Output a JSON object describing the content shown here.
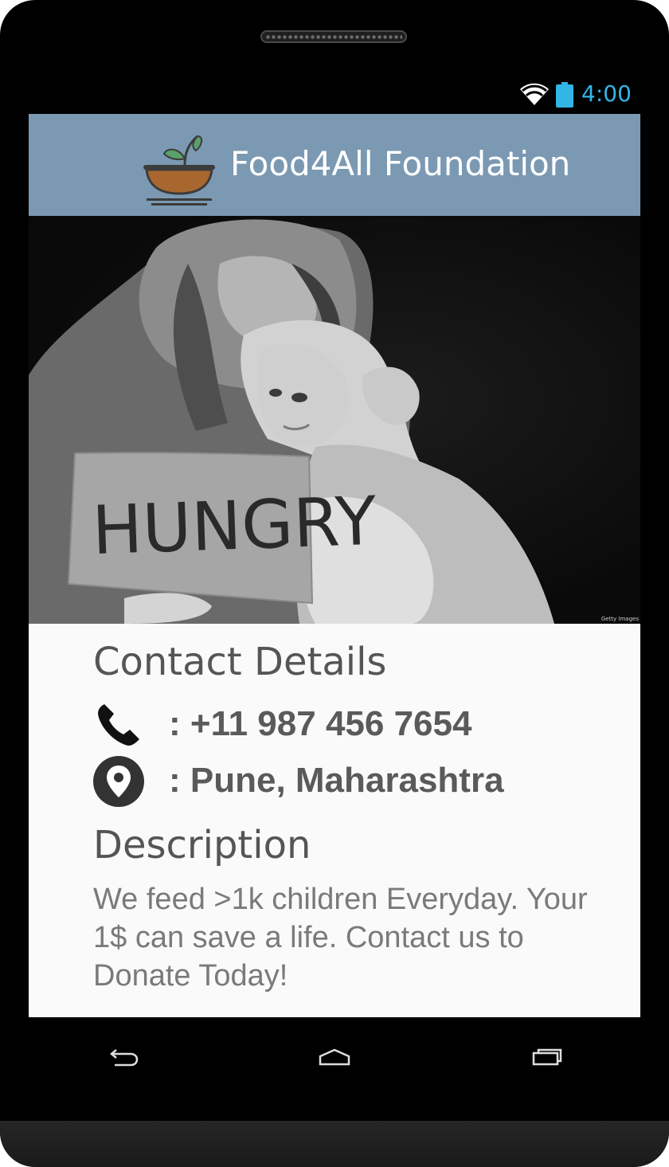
{
  "status_bar": {
    "time": "4:00",
    "wifi_icon": "wifi-icon",
    "battery_icon": "battery-icon",
    "accent_color": "#33b5e5"
  },
  "app_bar": {
    "title": "Food4All Foundation",
    "logo_icon": "plant-bowl-logo",
    "background_color": "#7b99b2"
  },
  "hero_image": {
    "sign_text": "HUNGRY",
    "watermark": "Getty Images"
  },
  "contact": {
    "heading": "Contact Details",
    "phone_icon": "phone-icon",
    "phone": ": +11 987 456 7654",
    "location_icon": "location-pin-icon",
    "location": ": Pune, Maharashtra"
  },
  "description": {
    "heading": "Description",
    "text": "We feed >1k children Everyday. Your 1$ can save a life. Contact us to Donate Today!"
  },
  "navigation": {
    "back_icon": "back-icon",
    "home_icon": "home-icon",
    "recents_icon": "recent-apps-icon"
  }
}
